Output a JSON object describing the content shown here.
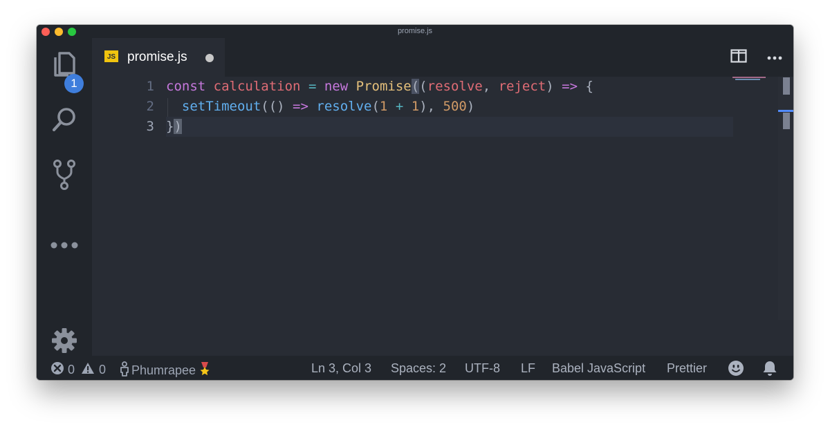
{
  "window": {
    "title": "promise.js"
  },
  "activity": {
    "explorer_badge": "1",
    "items": [
      "files-icon",
      "search-icon",
      "source-control-icon",
      "more-icon",
      "settings-gear-icon"
    ]
  },
  "tabs": [
    {
      "label": "promise.js",
      "icon_text": "JS",
      "dirty": true
    }
  ],
  "editor": {
    "line_numbers": [
      "1",
      "2",
      "3"
    ],
    "lines": [
      [
        {
          "t": "const",
          "c": "kw"
        },
        {
          "t": " ",
          "c": "pun"
        },
        {
          "t": "calculation",
          "c": "var"
        },
        {
          "t": " ",
          "c": "pun"
        },
        {
          "t": "=",
          "c": "op"
        },
        {
          "t": " ",
          "c": "pun"
        },
        {
          "t": "new",
          "c": "kw"
        },
        {
          "t": " ",
          "c": "pun"
        },
        {
          "t": "Promise",
          "c": "cls"
        },
        {
          "t": "(",
          "c": "pun match"
        },
        {
          "t": "(",
          "c": "pun"
        },
        {
          "t": "resolve",
          "c": "var"
        },
        {
          "t": ", ",
          "c": "pun"
        },
        {
          "t": "reject",
          "c": "var"
        },
        {
          "t": ") ",
          "c": "pun"
        },
        {
          "t": "=>",
          "c": "kw"
        },
        {
          "t": " {",
          "c": "pun"
        }
      ],
      [
        {
          "t": "  ",
          "c": "pun"
        },
        {
          "t": "setTimeout",
          "c": "fn"
        },
        {
          "t": "(() ",
          "c": "pun"
        },
        {
          "t": "=>",
          "c": "kw"
        },
        {
          "t": " ",
          "c": "pun"
        },
        {
          "t": "resolve",
          "c": "fn"
        },
        {
          "t": "(",
          "c": "pun"
        },
        {
          "t": "1",
          "c": "num"
        },
        {
          "t": " ",
          "c": "pun"
        },
        {
          "t": "+",
          "c": "op"
        },
        {
          "t": " ",
          "c": "pun"
        },
        {
          "t": "1",
          "c": "num"
        },
        {
          "t": "), ",
          "c": "pun"
        },
        {
          "t": "500",
          "c": "num"
        },
        {
          "t": ")",
          "c": "pun"
        }
      ],
      [
        {
          "t": "}",
          "c": "pun"
        },
        {
          "t": ")",
          "c": "pun cursor-cell"
        }
      ]
    ]
  },
  "status": {
    "errors": "0",
    "warnings": "0",
    "user": "Phumrapee",
    "position": "Ln 3, Col 3",
    "spaces": "Spaces: 2",
    "encoding": "UTF-8",
    "eol": "LF",
    "language": "Babel JavaScript",
    "formatter": "Prettier"
  },
  "colors": {
    "editor_bg": "#282c34",
    "chrome_bg": "#21252b",
    "badge": "#3f7edc",
    "keyword": "#c678dd",
    "variable": "#e06c75",
    "class": "#e5c07b",
    "function": "#61afef",
    "number": "#d19a66",
    "operator": "#56b6c2"
  }
}
